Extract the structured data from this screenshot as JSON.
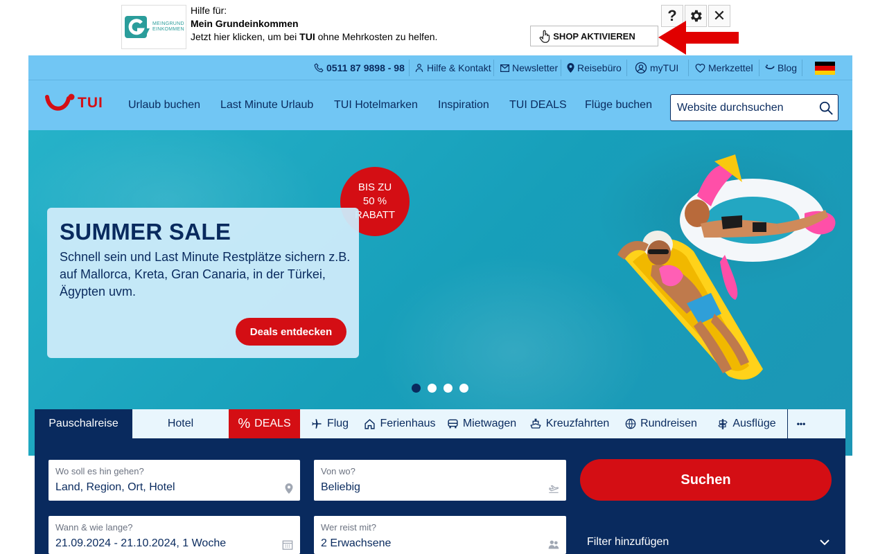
{
  "extension": {
    "logo_text_1": "MEINGRUND",
    "logo_text_2": "EINKOMMEN",
    "help_for": "Hilfe für:",
    "org_name": "Mein Grundeinkommen",
    "cta_prefix": "Jetzt hier klicken, um bei ",
    "cta_brand": "TUI",
    "cta_suffix": " ohne Mehrkosten zu helfen.",
    "help_label": "?",
    "close_label": "✕",
    "shop_button": "SHOP AKTIVIEREN"
  },
  "meta_nav": {
    "phone": "0511 87 9898 - 98",
    "help": "Hilfe & Kontakt",
    "newsletter": "Newsletter",
    "agency": "Reisebüro",
    "account": "myTUI",
    "wishlist": "Merkzettel",
    "blog": "Blog"
  },
  "brand": {
    "wordmark": "TUI",
    "accent": "#d40e14",
    "navy": "#092a5e",
    "sky": "#71c6f4"
  },
  "main_nav": {
    "items": [
      "Urlaub buchen",
      "Last Minute Urlaub",
      "TUI Hotelmarken",
      "Inspiration",
      "TUI DEALS",
      "Flüge buchen"
    ],
    "search_placeholder": "Website durchsuchen"
  },
  "hero": {
    "title": "SUMMER SALE",
    "text": "Schnell sein und Last Minute Restplätze sichern z.B. auf Mallorca, Kreta, Gran Canaria, in der Türkei, Ägypten uvm.",
    "button": "Deals entdecken",
    "badge_line1": "BIS ZU",
    "badge_line2": "50 %",
    "badge_line3": "RABATT",
    "slides": 4,
    "active_slide": 1
  },
  "tabs": {
    "package": "Pauschalreise",
    "hotel": "Hotel",
    "deals": "DEALS",
    "deals_symbol": "%",
    "flight": "Flug",
    "holiday_home": "Ferienhaus",
    "car": "Mietwagen",
    "cruise": "Kreuzfahrten",
    "tours": "Rundreisen",
    "excursions": "Ausflüge",
    "more": "•••"
  },
  "search": {
    "destination_label": "Wo soll es hin gehen?",
    "destination_value": "Land, Region, Ort, Hotel",
    "origin_label": "Von wo?",
    "origin_value": "Beliebig",
    "dates_label": "Wann & wie lange?",
    "dates_value": "21.09.2024 - 21.10.2024, 1 Woche",
    "travellers_label": "Wer reist mit?",
    "travellers_value": "2 Erwachsene",
    "submit": "Suchen",
    "filter": "Filter hinzufügen"
  }
}
